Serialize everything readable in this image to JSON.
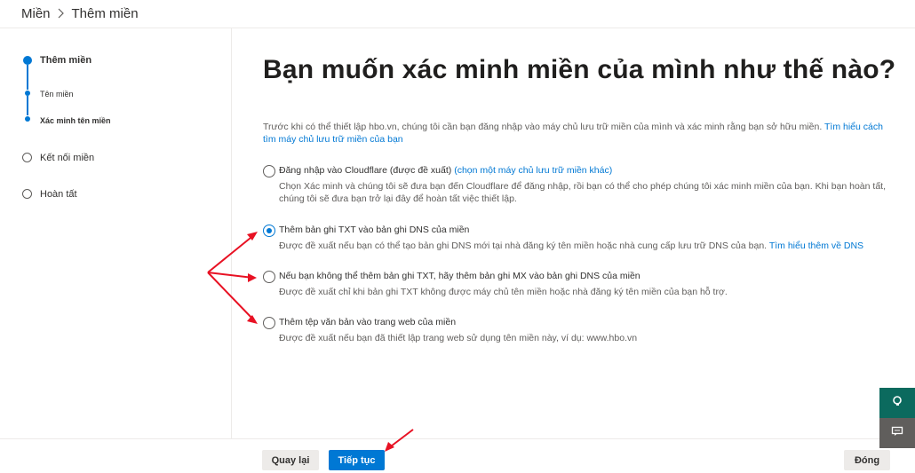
{
  "breadcrumb": {
    "parent": "Miền",
    "separator": ">",
    "current": "Thêm miền"
  },
  "steps": [
    {
      "label": "Thêm miền",
      "state": "current"
    },
    {
      "label": "Tên miền",
      "state": "completed-sub"
    },
    {
      "label": "Xác minh tên miền",
      "state": "current-sub"
    },
    {
      "label": "Kết nối miền",
      "state": "pending"
    },
    {
      "label": "Hoàn tất",
      "state": "pending"
    }
  ],
  "main": {
    "title": "Bạn muốn xác minh miền của mình như thế nào?",
    "intro": "Trước khi có thể thiết lập hbo.vn, chúng tôi cần bạn đăng nhập vào máy chủ lưu trữ miền của mình và xác minh rằng bạn sở hữu miền.",
    "intro_link": "Tìm hiểu cách tìm máy chủ lưu trữ miền của bạn"
  },
  "options": [
    {
      "title": "Đăng nhập vào Cloudflare (được đề xuất)",
      "title_link": "(chọn một máy chủ lưu trữ miền khác)",
      "desc": "Chọn Xác minh và chúng tôi sẽ đưa bạn đến Cloudflare để đăng nhập, rồi bạn có thể cho phép chúng tôi xác minh miền của bạn. Khi bạn hoàn tất, chúng tôi sẽ đưa bạn trở lại đây để hoàn tất việc thiết lập.",
      "desc_link": "",
      "checked": false
    },
    {
      "title": "Thêm bản ghi TXT vào bản ghi DNS của miền",
      "title_link": "",
      "desc": "Được đề xuất nếu bạn có thể tạo bản ghi DNS mới tại nhà đăng ký tên miền hoặc nhà cung cấp lưu trữ DNS của bạn.",
      "desc_link": "Tìm hiểu thêm về DNS",
      "checked": true
    },
    {
      "title": "Nếu bạn không thể thêm bản ghi TXT, hãy thêm bản ghi MX vào bản ghi DNS của miền",
      "title_link": "",
      "desc": "Được đề xuất chỉ khi bản ghi TXT không được máy chủ tên miền hoặc nhà đăng ký tên miền của bạn hỗ trợ.",
      "desc_link": "",
      "checked": false
    },
    {
      "title": "Thêm tệp văn bản vào trang web của miền",
      "title_link": "",
      "desc": "Được đề xuất nếu bạn đã thiết lập trang web sử dụng tên miền này, ví dụ: www.hbo.vn",
      "desc_link": "",
      "checked": false
    }
  ],
  "footer": {
    "back": "Quay lại",
    "next": "Tiếp tục",
    "close": "Đóng"
  },
  "colors": {
    "accent": "#0078d4",
    "annotation": "#e81123",
    "side_green": "#0b6a5e"
  },
  "side_buttons": [
    {
      "icon": "headset-icon"
    },
    {
      "icon": "chat-icon"
    }
  ]
}
